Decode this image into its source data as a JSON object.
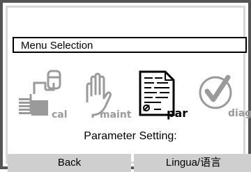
{
  "menu": {
    "title": "Menu Selection"
  },
  "icons": [
    {
      "name": "cal",
      "label": "cal",
      "active": false
    },
    {
      "name": "maint",
      "label": "maint",
      "active": false
    },
    {
      "name": "par",
      "label": "par",
      "active": true
    },
    {
      "name": "diag",
      "label": "diag",
      "active": false
    }
  ],
  "status": {
    "text": "Parameter Setting:"
  },
  "softkeys": {
    "left": "Back",
    "right": "Lingua/语言"
  },
  "colors": {
    "inactive_icon": "#9a9a9a",
    "softkey_bg": "#cfcfcf",
    "frame": "#d6d6d6"
  }
}
